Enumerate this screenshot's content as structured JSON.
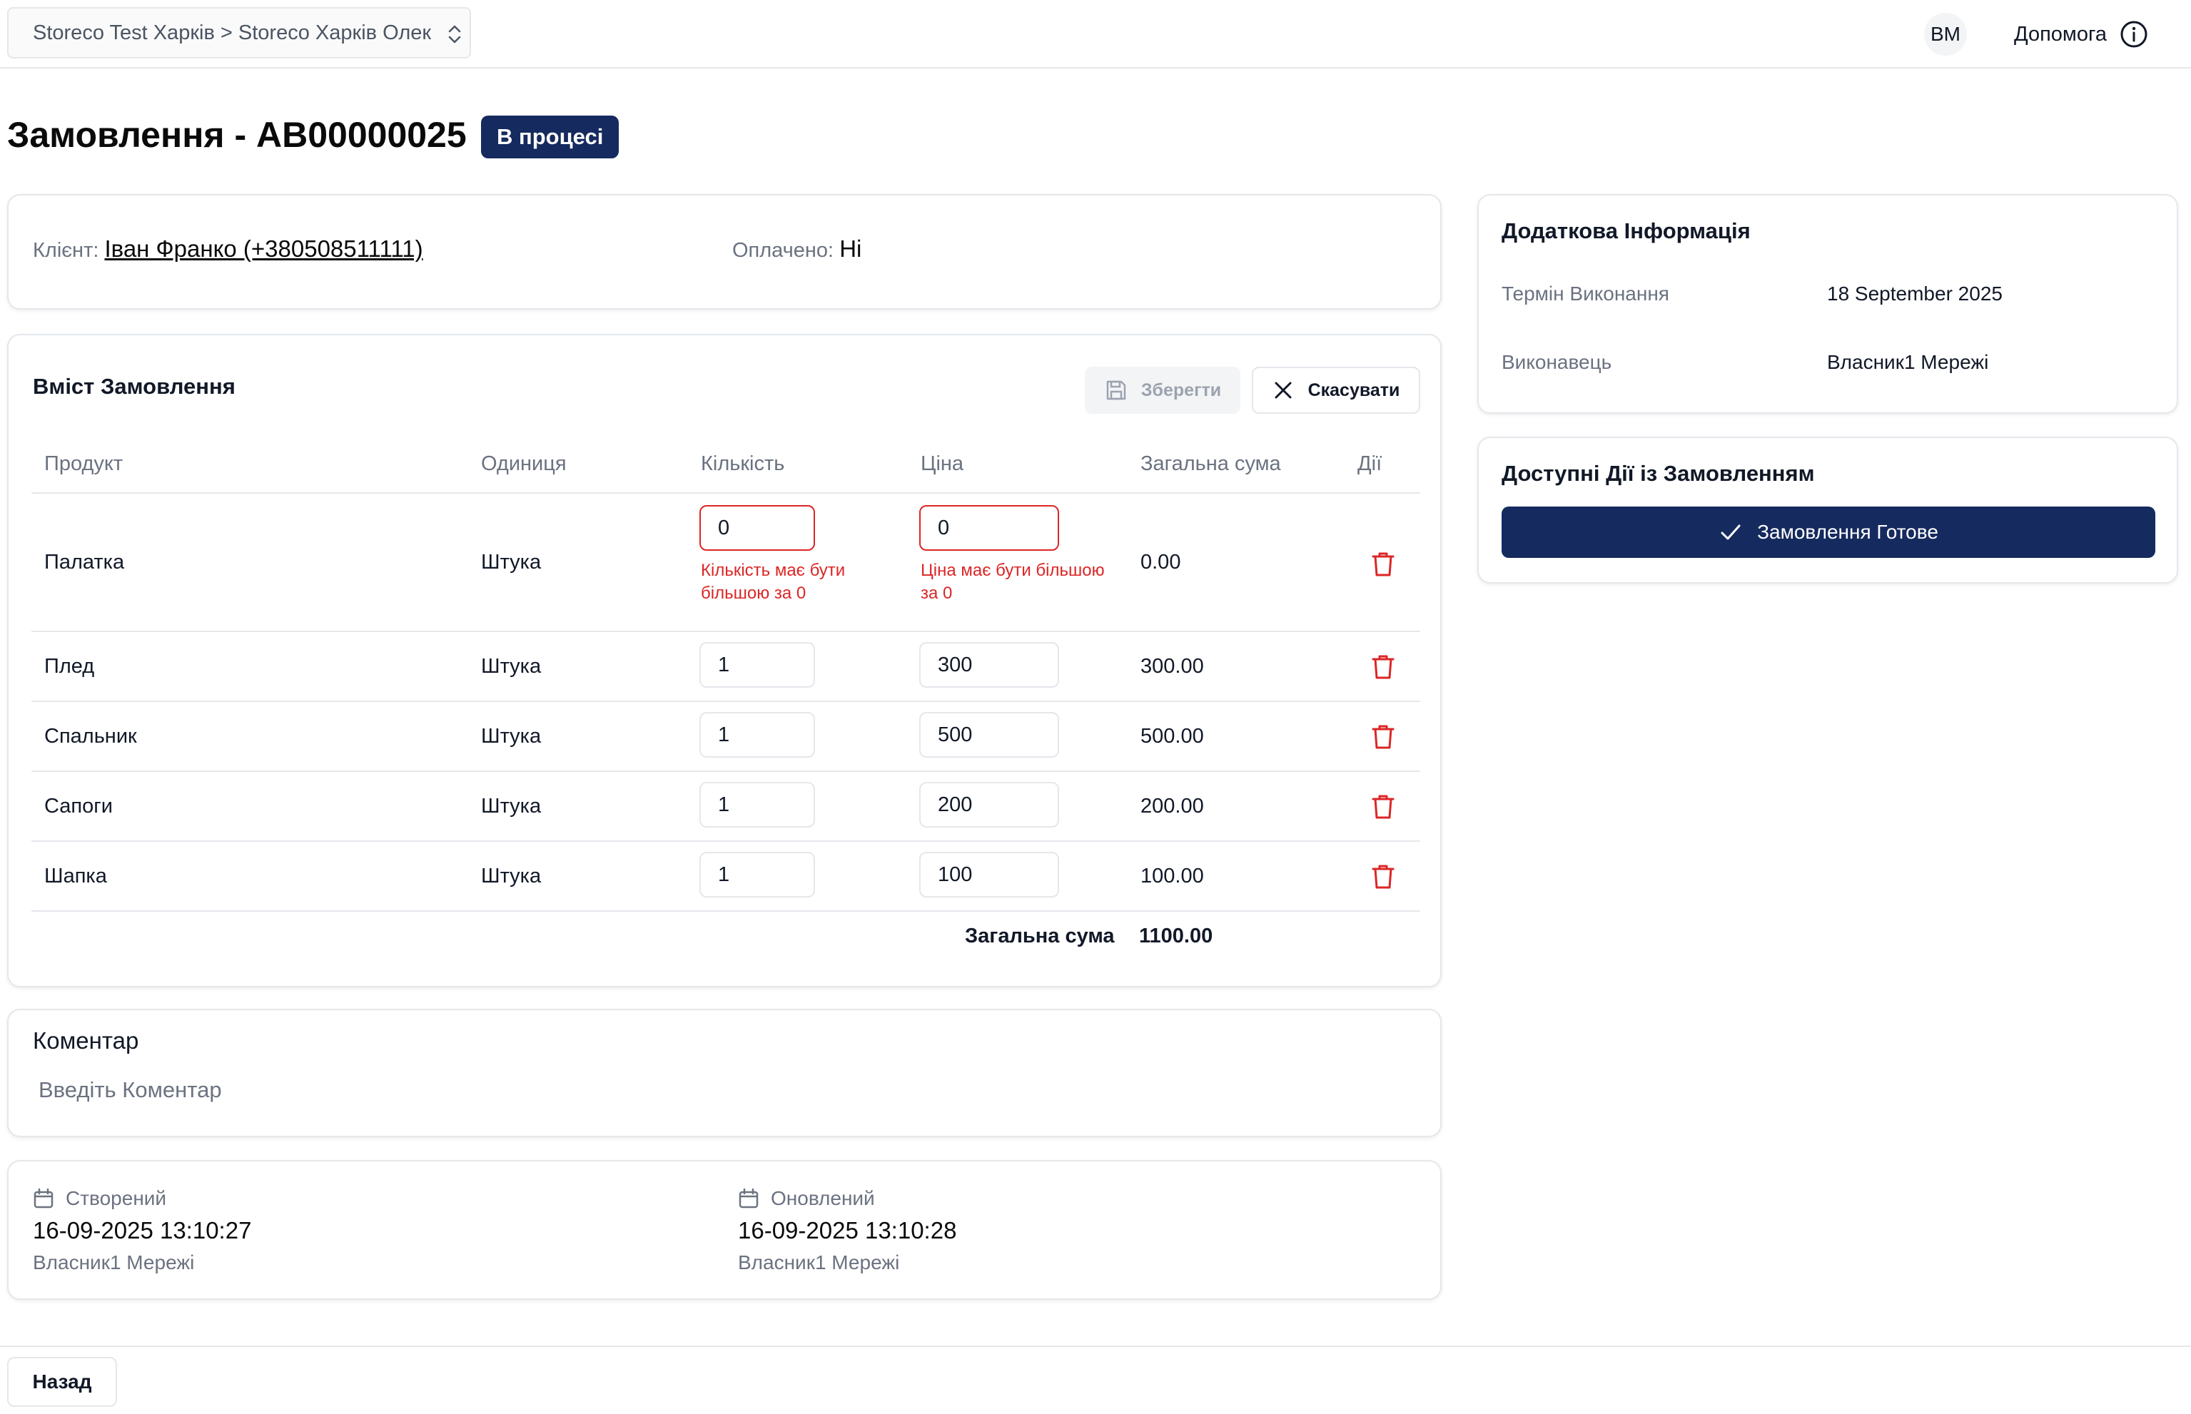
{
  "header": {
    "store_selector": "Storeco Test Харків > Storeco Харків Олек",
    "avatar_initials": "BM",
    "help_label": "Допомога"
  },
  "page": {
    "title": "Замовлення - AB00000025",
    "status": "В процесі"
  },
  "client_card": {
    "client_label": "Клієнт:",
    "client_value": "Іван Франко (+380508511111)",
    "paid_label": "Оплачено:",
    "paid_value": "Ні"
  },
  "order": {
    "title": "Вміст Замовлення",
    "save_label": "Зберегти",
    "cancel_label": "Скасувати",
    "columns": [
      "Продукт",
      "Одиниця",
      "Кількість",
      "Ціна",
      "Загальна сума",
      "Дії"
    ],
    "rows": [
      {
        "product": "Палатка",
        "unit": "Штука",
        "qty": "0",
        "price": "0",
        "total": "0.00",
        "qty_error": "Кількість має бути більшою за 0",
        "price_error": "Ціна має бути більшою за 0"
      },
      {
        "product": "Плед",
        "unit": "Штука",
        "qty": "1",
        "price": "300",
        "total": "300.00"
      },
      {
        "product": "Спальник",
        "unit": "Штука",
        "qty": "1",
        "price": "500",
        "total": "500.00"
      },
      {
        "product": "Сапоги",
        "unit": "Штука",
        "qty": "1",
        "price": "200",
        "total": "200.00"
      },
      {
        "product": "Шапка",
        "unit": "Штука",
        "qty": "1",
        "price": "100",
        "total": "100.00"
      }
    ],
    "total_label": "Загальна сума",
    "total_value": "1100.00"
  },
  "comment": {
    "title": "Коментар",
    "placeholder": "Введіть Коментар"
  },
  "meta": {
    "created_label": "Створений",
    "created_datetime": "16-09-2025 13:10:27",
    "created_by": "Власник1 Мережі",
    "updated_label": "Оновлений",
    "updated_datetime": "16-09-2025 13:10:28",
    "updated_by": "Власник1 Мережі"
  },
  "info": {
    "title": "Додаткова Інформація",
    "deadline_label": "Термін Виконання",
    "deadline_value": "18 September 2025",
    "executor_label": "Виконавець",
    "executor_value": "Власник1 Мережі"
  },
  "actions": {
    "title": "Доступні Дії із Замовленням",
    "ready_label": "Замовлення Готове"
  },
  "footer": {
    "back_label": "Назад"
  },
  "colors": {
    "primary": "#152a5e",
    "error": "#dc2626",
    "border": "#e5e7eb",
    "muted_text": "#6b7280"
  }
}
